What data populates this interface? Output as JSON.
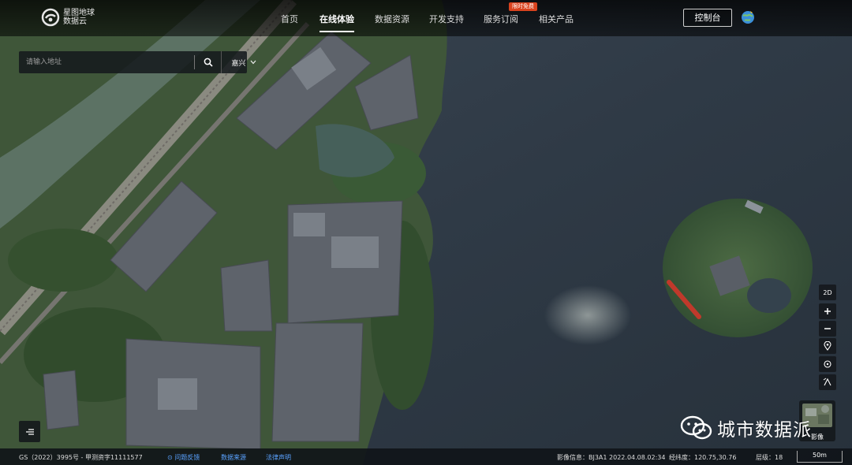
{
  "brand": {
    "logo_line1": "星图地球",
    "logo_line2": "数据云"
  },
  "nav": {
    "items": [
      {
        "label": "首页"
      },
      {
        "label": "在线体验"
      },
      {
        "label": "数据资源"
      },
      {
        "label": "开发支持"
      },
      {
        "label": "服务订阅"
      },
      {
        "label": "相关产品"
      }
    ],
    "active": "在线体验",
    "promo_badge": "限时免费",
    "console_label": "控制台"
  },
  "search": {
    "placeholder": "请输入地址",
    "city": "嘉兴"
  },
  "tools": {
    "view_mode": "2D",
    "layer_label": "影像"
  },
  "watermark": {
    "text": "城市数据派"
  },
  "footer": {
    "license": "GS（2022）3995号 - 甲测资字11111577",
    "feedback": "问题反馈",
    "data_source": "数据来源",
    "legal": "法律声明",
    "imagery_info": "影像信息：BJ3A1 2022.04.08.02:34",
    "coords": "经纬度：120.75,30.76",
    "level": "层级：18",
    "scale": "50m"
  },
  "colors": {
    "water": "#2e3a47",
    "vegetation": "#3d5a3a",
    "roof": "#5c6068",
    "link": "#5aa2ff",
    "badge": "#d9431e",
    "boat": "#c0392b"
  }
}
